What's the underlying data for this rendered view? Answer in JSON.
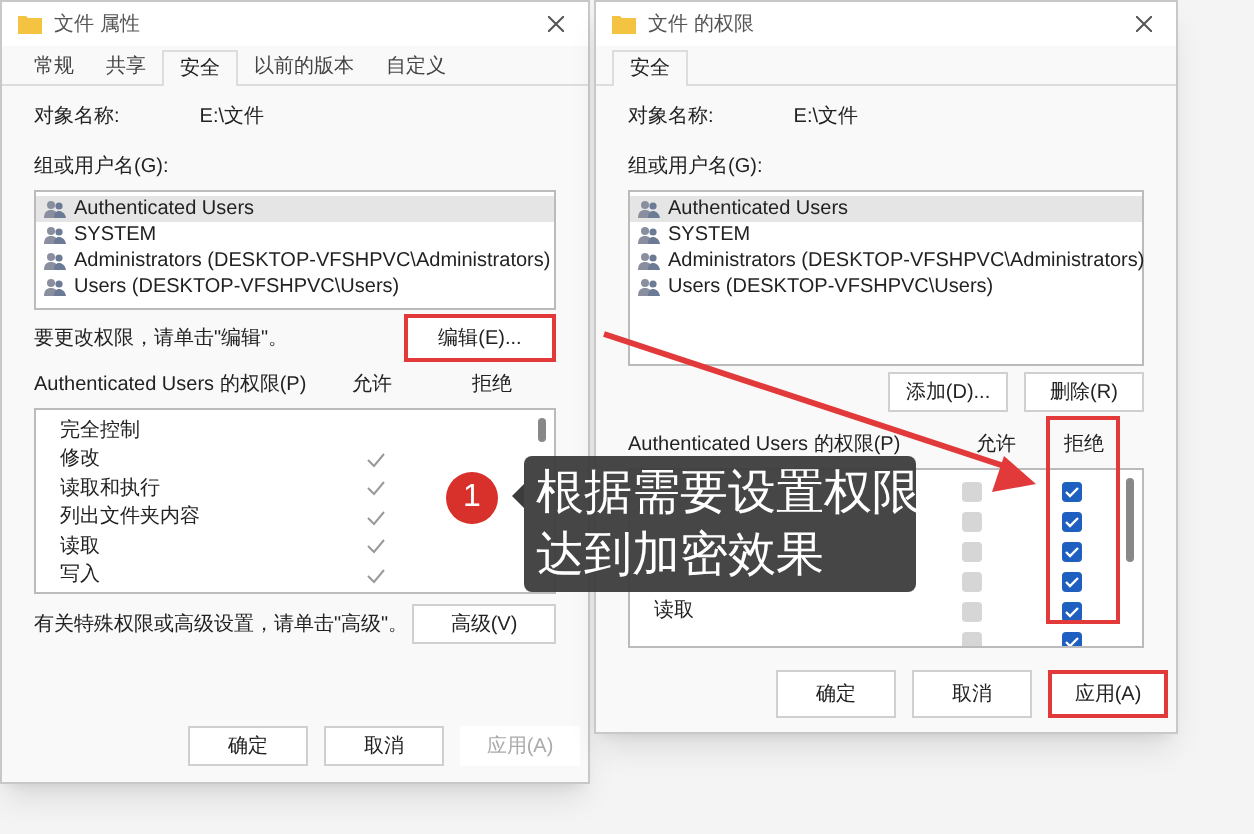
{
  "left_dialog": {
    "title": "文件 属性",
    "tabs": [
      {
        "label": "常规",
        "selected": false
      },
      {
        "label": "共享",
        "selected": false
      },
      {
        "label": "安全",
        "selected": true
      },
      {
        "label": "以前的版本",
        "selected": false
      },
      {
        "label": "自定义",
        "selected": false
      }
    ],
    "object_label": "对象名称:",
    "object_value": "E:\\文件",
    "group_label": "组或用户名(G):",
    "users": [
      {
        "name": "Authenticated Users",
        "selected": true
      },
      {
        "name": "SYSTEM",
        "selected": false
      },
      {
        "name": "Administrators (DESKTOP-VFSHPVC\\Administrators)",
        "selected": false
      },
      {
        "name": "Users (DESKTOP-VFSHPVC\\Users)",
        "selected": false
      }
    ],
    "edit_hint": "要更改权限，请单击\"编辑\"。",
    "edit_button": {
      "label": "编辑(E)...",
      "highlighted": true
    },
    "perm_label": "Authenticated Users 的权限(P)",
    "allow_header": "允许",
    "deny_header": "拒绝",
    "permissions": [
      {
        "name": "完全控制",
        "allow": false,
        "deny": false
      },
      {
        "name": "修改",
        "allow": true,
        "deny": false
      },
      {
        "name": "读取和执行",
        "allow": true,
        "deny": false
      },
      {
        "name": "列出文件夹内容",
        "allow": true,
        "deny": false
      },
      {
        "name": "读取",
        "allow": true,
        "deny": false
      },
      {
        "name": "写入",
        "allow": true,
        "deny": false
      }
    ],
    "advanced_hint": "有关特殊权限或高级设置，请单击\"高级\"。",
    "advanced_button": "高级(V)",
    "buttons": [
      {
        "label": "确定",
        "disabled": false
      },
      {
        "label": "取消",
        "disabled": false
      },
      {
        "label": "应用(A)",
        "disabled": true
      }
    ]
  },
  "right_dialog": {
    "title": "文件 的权限",
    "tabs": [
      {
        "label": "安全",
        "selected": true
      }
    ],
    "object_label": "对象名称:",
    "object_value": "E:\\文件",
    "group_label": "组或用户名(G):",
    "users": [
      {
        "name": "Authenticated Users",
        "selected": true
      },
      {
        "name": "SYSTEM",
        "selected": false
      },
      {
        "name": "Administrators (DESKTOP-VFSHPVC\\Administrators)",
        "selected": false
      },
      {
        "name": "Users (DESKTOP-VFSHPVC\\Users)",
        "selected": false
      }
    ],
    "add_button": "添加(D)...",
    "remove_button": "删除(R)",
    "perm_label": "Authenticated Users 的权限(P)",
    "allow_header": "允许",
    "deny_header": "拒绝",
    "deny_column_highlighted": true,
    "permissions": [
      {
        "allow": false,
        "deny": true
      },
      {
        "allow": false,
        "deny": true
      },
      {
        "allow": false,
        "deny": true
      },
      {
        "allow": false,
        "deny": true
      },
      {
        "name": "读取",
        "allow": false,
        "deny": true
      },
      {
        "allow": false,
        "deny": true
      }
    ],
    "buttons": [
      {
        "label": "确定",
        "highlighted": false
      },
      {
        "label": "取消",
        "highlighted": false
      },
      {
        "label": "应用(A)",
        "highlighted": true
      }
    ]
  },
  "annotation": {
    "step": "1",
    "lines": [
      "根据需要设置权限",
      "达到加密效果"
    ]
  }
}
